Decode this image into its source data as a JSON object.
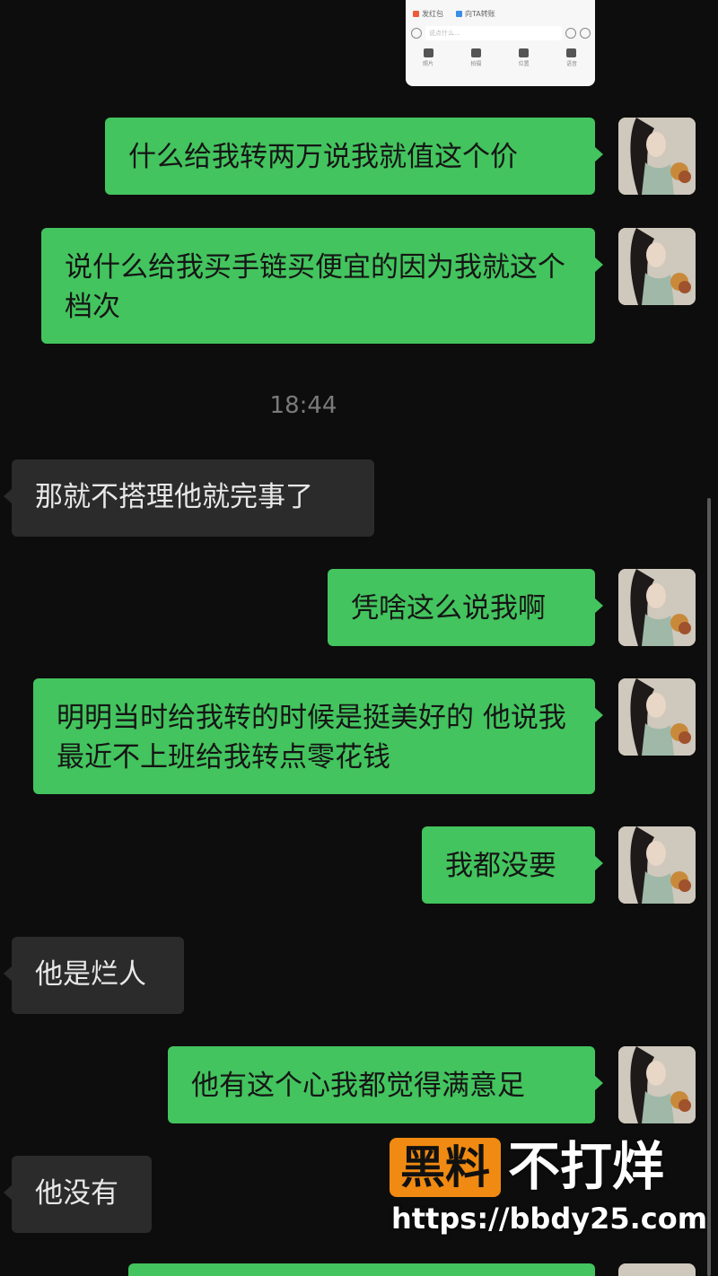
{
  "embed": {
    "action_1": "发红包",
    "action_2": "向TA转账",
    "input_placeholder": "说点什么...",
    "tools": [
      "照片",
      "拍摄",
      "位置",
      "语音"
    ]
  },
  "messages": [
    {
      "side": "out",
      "text": "什么给我转两万说我就值这个价"
    },
    {
      "side": "out",
      "text": "说什么给我买手链买便宜的因为我就这个档次"
    },
    {
      "side": "in",
      "text": "那就不搭理他就完事了"
    },
    {
      "side": "out",
      "text": "凭啥这么说我啊"
    },
    {
      "side": "out",
      "text": "明明当时给我转的时候是挺美好的 他说我最近不上班给我转点零花钱"
    },
    {
      "side": "out",
      "text": "我都没要"
    },
    {
      "side": "in",
      "text": "他是烂人"
    },
    {
      "side": "out",
      "text": "他有这个心我都觉得满意足"
    },
    {
      "side": "in",
      "text": "他没有"
    }
  ],
  "timestamp": "18:44",
  "watermark": {
    "badge": "黑料",
    "title": "不打烊",
    "url": "https://bbdy25.com"
  },
  "colors": {
    "background": "#0d0d0d",
    "outgoing_bubble": "#43c45e",
    "incoming_bubble": "#2b2b2b",
    "watermark_badge": "#f08a12"
  }
}
